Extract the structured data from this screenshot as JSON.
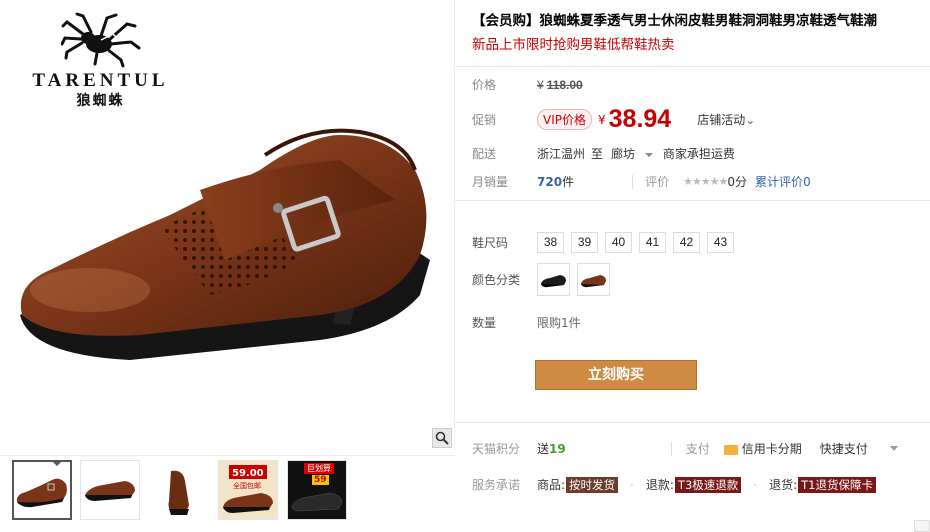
{
  "brand": {
    "name_en": "TARENTUL",
    "name_cn": "狼蜘蛛"
  },
  "gallery": {
    "thumbnails": [
      {
        "name": "thumb-1",
        "active": true
      },
      {
        "name": "thumb-2",
        "active": false
      },
      {
        "name": "thumb-3",
        "active": false
      },
      {
        "name": "thumb-4",
        "promo_price": "59.00",
        "promo_caption": "全国包邮",
        "active": false
      },
      {
        "name": "thumb-5",
        "promo_price": "59",
        "promo_caption": "巨划算",
        "active": false
      }
    ]
  },
  "product": {
    "title": "【会员购】狼蜘蛛夏季透气男士休闲皮鞋男鞋洞洞鞋男凉鞋透气鞋潮",
    "subtitle": "新品上市限时抢购男鞋低帮鞋热卖"
  },
  "price": {
    "label": "价格",
    "currency": "¥",
    "original": "118.00"
  },
  "promo": {
    "label": "促销",
    "vip_tag": "VIP价格",
    "currency": "¥",
    "price": "38.94",
    "store_activity": "店铺活动",
    "store_activity_arrow": "⌄"
  },
  "shipping": {
    "label": "配送",
    "from": "浙江温州",
    "to_word": "至",
    "destination": "廊坊",
    "fee": "商家承担运费"
  },
  "sales": {
    "label": "月销量",
    "count": "720",
    "unit": "件",
    "rating_label": "评价",
    "stars": "★★★★★",
    "score": "0分",
    "cumulative": "累计评价",
    "cumulative_count": "0"
  },
  "sizes": {
    "label": "鞋尺码",
    "options": [
      "38",
      "39",
      "40",
      "41",
      "42",
      "43"
    ]
  },
  "colors": {
    "label": "颜色分类"
  },
  "quantity": {
    "label": "数量",
    "limit": "限购1件"
  },
  "buy": {
    "label": "立刻购买"
  },
  "points": {
    "label": "天猫积分",
    "text": "送",
    "value": "19"
  },
  "payment": {
    "label": "支付",
    "credit": "信用卡分期",
    "quick": "快捷支付"
  },
  "service": {
    "label": "服务承诺",
    "goods_label": "商品:",
    "goods_tag": "按时发货",
    "refund_label": "退款:",
    "refund_tag": "T3极速退款",
    "return_label": "退货:",
    "return_tag": "T1退货保障卡"
  },
  "colors_theme": {
    "price_red": "#c40000",
    "buy_button": "#cf8a44",
    "link_blue": "#3366a8"
  }
}
